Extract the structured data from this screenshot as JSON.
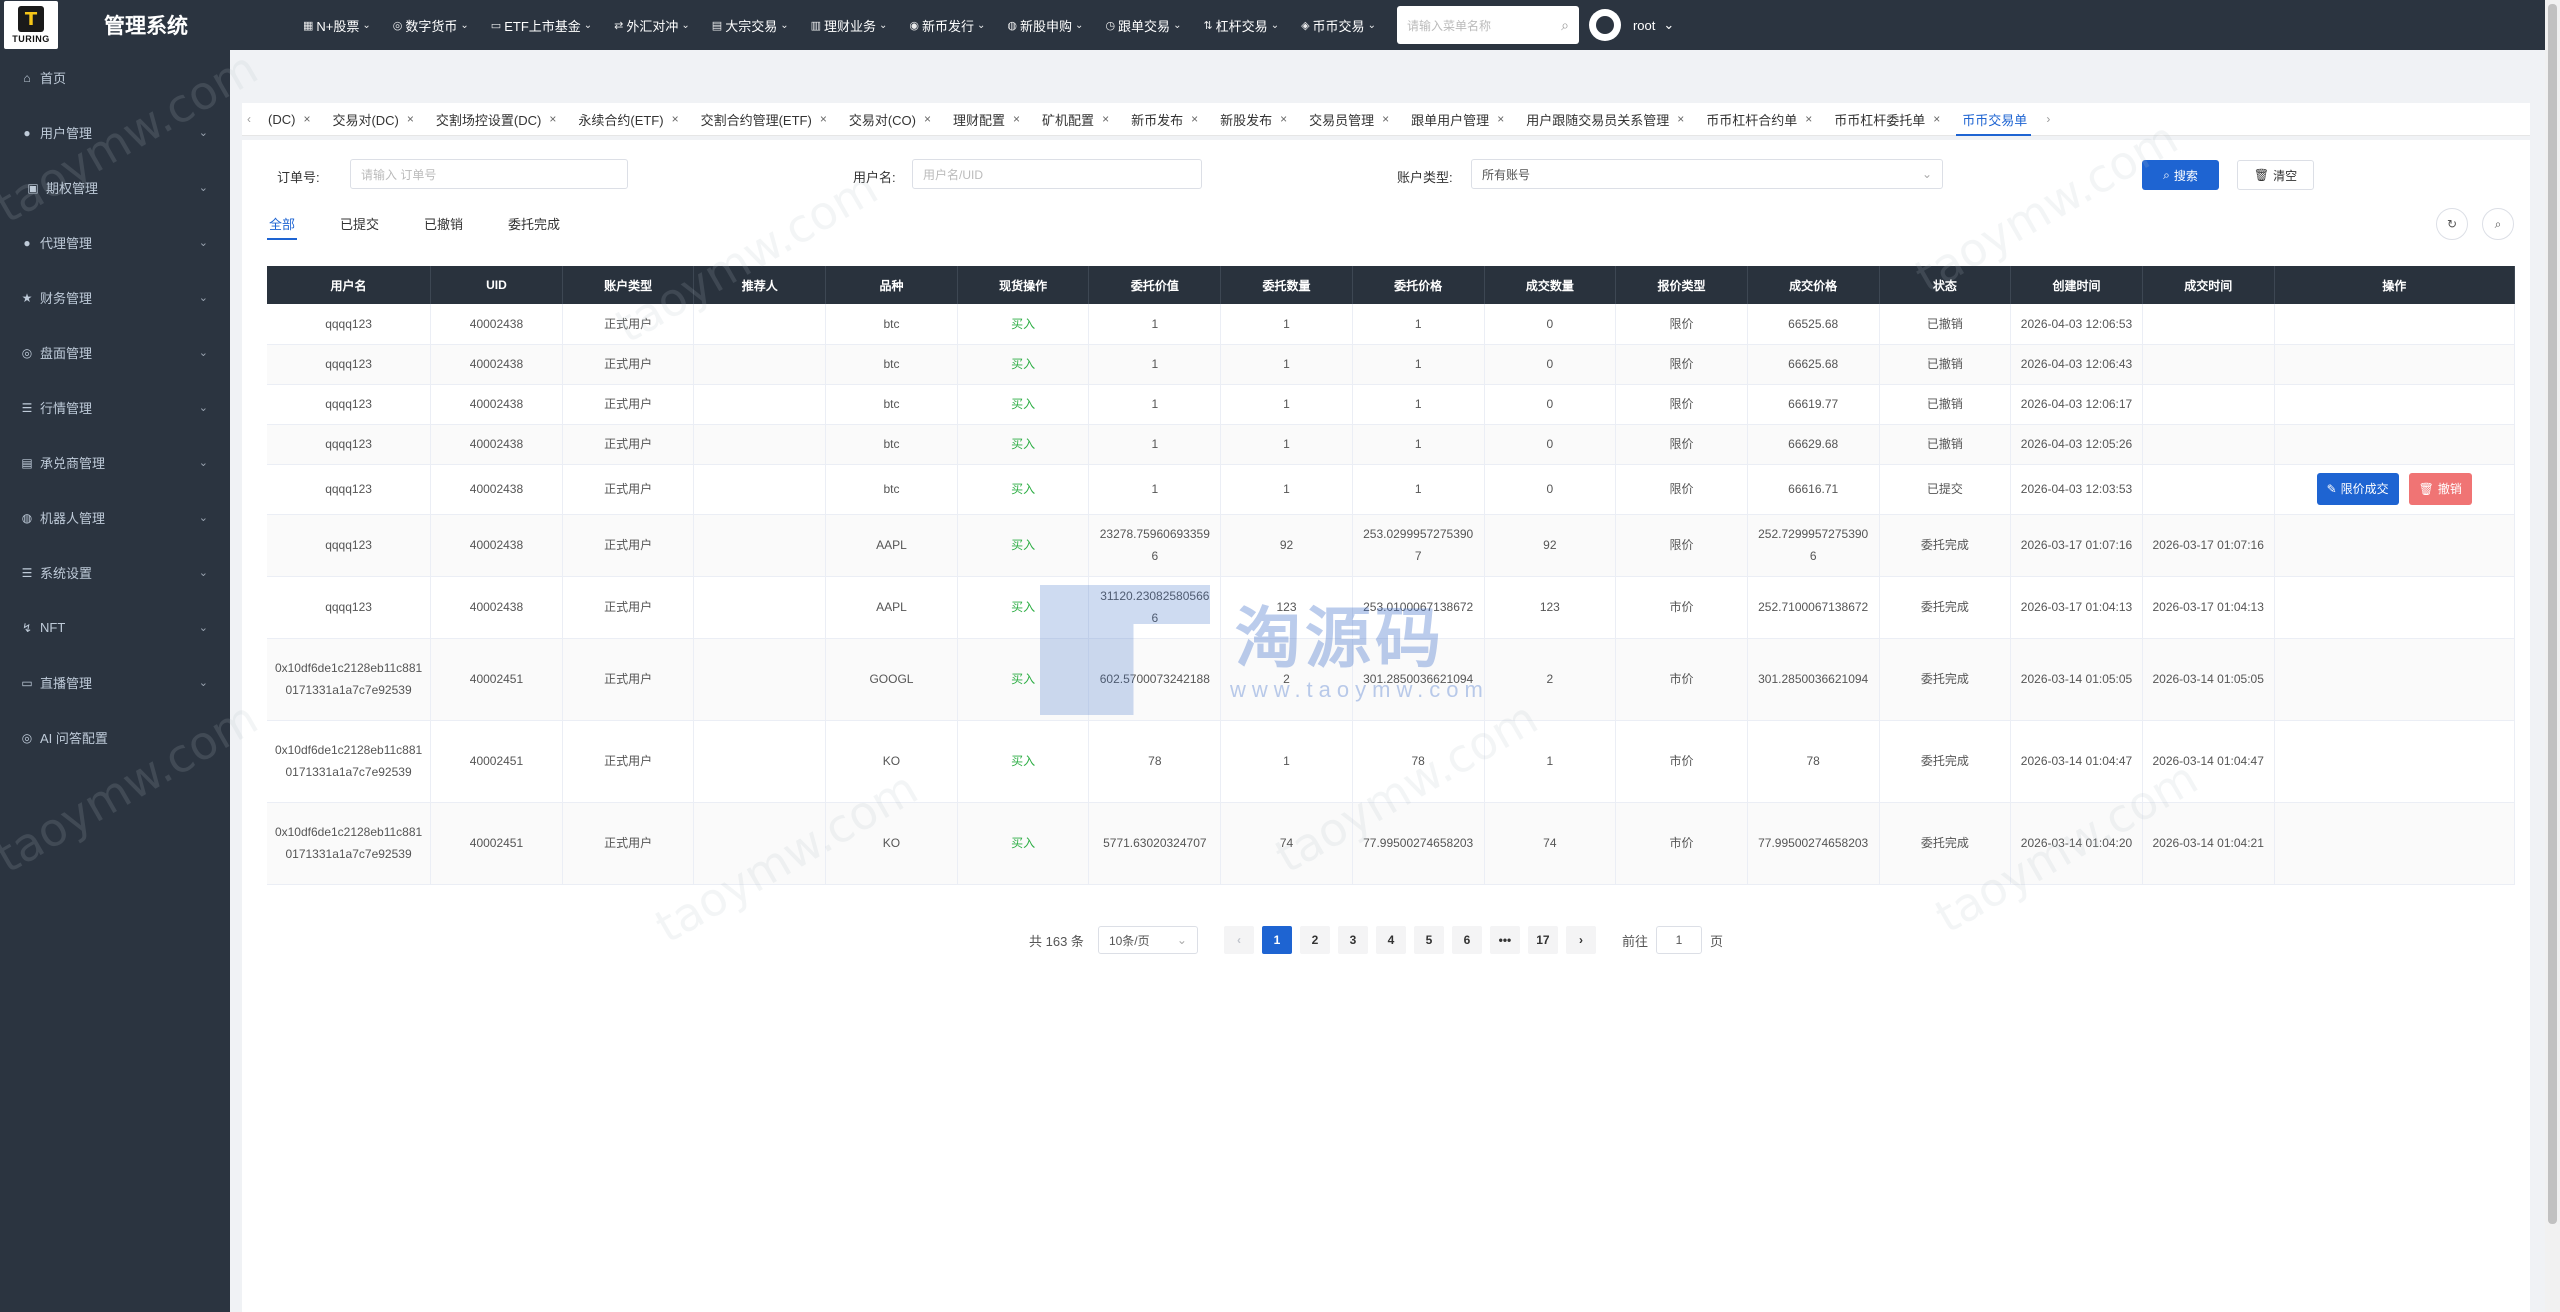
{
  "app": {
    "logo_mark": "T",
    "logo_text": "TURING",
    "title": "管理系统"
  },
  "topnav": [
    {
      "label": "N+股票",
      "icon": "stock-icon"
    },
    {
      "label": "数字货币",
      "icon": "coin-icon"
    },
    {
      "label": "ETF上市基金",
      "icon": "fund-icon"
    },
    {
      "label": "外汇对冲",
      "icon": "forex-icon"
    },
    {
      "label": "大宗交易",
      "icon": "bulk-icon"
    },
    {
      "label": "理财业务",
      "icon": "finance-icon"
    },
    {
      "label": "新币发行",
      "icon": "newcoin-icon"
    },
    {
      "label": "新股申购",
      "icon": "ipo-icon"
    },
    {
      "label": "跟单交易",
      "icon": "copy-trade-icon"
    },
    {
      "label": "杠杆交易",
      "icon": "leverage-icon"
    },
    {
      "label": "币币交易",
      "icon": "spot-icon"
    }
  ],
  "search": {
    "placeholder": "请输入菜单名称"
  },
  "user": {
    "name": "root"
  },
  "sidebar": [
    {
      "label": "首页",
      "icon": "home-icon",
      "expandable": false
    },
    {
      "label": "用户管理",
      "icon": "user-icon",
      "expandable": true
    },
    {
      "label": "期权管理",
      "icon": "option-icon",
      "expandable": true
    },
    {
      "label": "代理管理",
      "icon": "agent-icon",
      "expandable": true
    },
    {
      "label": "财务管理",
      "icon": "star-icon",
      "expandable": true
    },
    {
      "label": "盘面管理",
      "icon": "market-board-icon",
      "expandable": true
    },
    {
      "label": "行情管理",
      "icon": "list-icon",
      "expandable": true
    },
    {
      "label": "承兑商管理",
      "icon": "merchant-icon",
      "expandable": true
    },
    {
      "label": "机器人管理",
      "icon": "robot-icon",
      "expandable": true
    },
    {
      "label": "系统设置",
      "icon": "settings-icon",
      "expandable": true
    },
    {
      "label": "NFT",
      "icon": "nft-icon",
      "expandable": true
    },
    {
      "label": "直播管理",
      "icon": "live-icon",
      "expandable": true
    },
    {
      "label": "AI 问答配置",
      "icon": "ai-icon",
      "expandable": false
    }
  ],
  "tabs": [
    {
      "label": "(DC)",
      "active": false
    },
    {
      "label": "交易对(DC)",
      "active": false
    },
    {
      "label": "交割场控设置(DC)",
      "active": false
    },
    {
      "label": "永续合约(ETF)",
      "active": false
    },
    {
      "label": "交割合约管理(ETF)",
      "active": false
    },
    {
      "label": "交易对(CO)",
      "active": false
    },
    {
      "label": "理财配置",
      "active": false
    },
    {
      "label": "矿机配置",
      "active": false
    },
    {
      "label": "新币发布",
      "active": false
    },
    {
      "label": "新股发布",
      "active": false
    },
    {
      "label": "交易员管理",
      "active": false
    },
    {
      "label": "跟单用户管理",
      "active": false
    },
    {
      "label": "用户跟随交易员关系管理",
      "active": false
    },
    {
      "label": "币币杠杆合约单",
      "active": false
    },
    {
      "label": "币币杠杆委托单",
      "active": false
    },
    {
      "label": "币币交易单",
      "active": true
    }
  ],
  "filters": {
    "order_label": "订单号:",
    "order_placeholder": "请输入 订单号",
    "user_label": "用户名:",
    "user_placeholder": "用户名/UID",
    "account_label": "账户类型:",
    "account_value": "所有账号",
    "search_btn": "搜索",
    "reset_btn": "清空"
  },
  "subtabs": [
    {
      "label": "全部",
      "active": true
    },
    {
      "label": "已提交",
      "active": false
    },
    {
      "label": "已撤销",
      "active": false
    },
    {
      "label": "委托完成",
      "active": false
    }
  ],
  "table": {
    "columns": [
      "用户名",
      "UID",
      "账户类型",
      "推荐人",
      "品种",
      "现货操作",
      "委托价值",
      "委托数量",
      "委托价格",
      "成交数量",
      "报价类型",
      "成交价格",
      "状态",
      "创建时间",
      "成交时间",
      "操作"
    ],
    "rows": [
      [
        "qqqq123",
        "40002438",
        "正式用户",
        "",
        "btc",
        "买入",
        "1",
        "1",
        "1",
        "0",
        "限价",
        "66525.68",
        "已撤销",
        "2026-04-03 12:06:53",
        "",
        ""
      ],
      [
        "qqqq123",
        "40002438",
        "正式用户",
        "",
        "btc",
        "买入",
        "1",
        "1",
        "1",
        "0",
        "限价",
        "66625.68",
        "已撤销",
        "2026-04-03 12:06:43",
        "",
        ""
      ],
      [
        "qqqq123",
        "40002438",
        "正式用户",
        "",
        "btc",
        "买入",
        "1",
        "1",
        "1",
        "0",
        "限价",
        "66619.77",
        "已撤销",
        "2026-04-03 12:06:17",
        "",
        ""
      ],
      [
        "qqqq123",
        "40002438",
        "正式用户",
        "",
        "btc",
        "买入",
        "1",
        "1",
        "1",
        "0",
        "限价",
        "66629.68",
        "已撤销",
        "2026-04-03 12:05:26",
        "",
        ""
      ],
      [
        "qqqq123",
        "40002438",
        "正式用户",
        "",
        "btc",
        "买入",
        "1",
        "1",
        "1",
        "0",
        "限价",
        "66616.71",
        "已提交",
        "2026-04-03 12:03:53",
        "",
        "actions"
      ],
      [
        "qqqq123",
        "40002438",
        "正式用户",
        "",
        "AAPL",
        "买入",
        "23278.75960693359 6",
        "92",
        "253.0299957275390 7",
        "92",
        "限价",
        "252.7299957275390 6",
        "委托完成",
        "2026-03-17 01:07:16",
        "2026-03-17 01:07:16",
        ""
      ],
      [
        "qqqq123",
        "40002438",
        "正式用户",
        "",
        "AAPL",
        "买入",
        "31120.23082580566 6",
        "123",
        "253.0100067138672",
        "123",
        "市价",
        "252.7100067138672",
        "委托完成",
        "2026-03-17 01:04:13",
        "2026-03-17 01:04:13",
        ""
      ],
      [
        "0x10df6de1c2128eb11c8810171331a1a7c7e92539",
        "40002451",
        "正式用户",
        "",
        "GOOGL",
        "买入",
        "602.5700073242188",
        "2",
        "301.2850036621094",
        "2",
        "市价",
        "301.2850036621094",
        "委托完成",
        "2026-03-14 01:05:05",
        "2026-03-14 01:05:05",
        ""
      ],
      [
        "0x10df6de1c2128eb11c8810171331a1a7c7e92539",
        "40002451",
        "正式用户",
        "",
        "KO",
        "买入",
        "78",
        "1",
        "78",
        "1",
        "市价",
        "78",
        "委托完成",
        "2026-03-14 01:04:47",
        "2026-03-14 01:04:47",
        ""
      ],
      [
        "0x10df6de1c2128eb11c8810171331a1a7c7e92539",
        "40002451",
        "正式用户",
        "",
        "KO",
        "买入",
        "5771.63020324707",
        "74",
        "77.99500274658203",
        "74",
        "市价",
        "77.99500274658203",
        "委托完成",
        "2026-03-14 01:04:20",
        "2026-03-14 01:04:21",
        ""
      ]
    ],
    "action_limit": "限价成交",
    "action_cancel": "撤销"
  },
  "pagination": {
    "total": "共 163 条",
    "page_size": "10条/页",
    "pages": [
      "1",
      "2",
      "3",
      "4",
      "5",
      "6",
      "•••",
      "17"
    ],
    "current": "1",
    "goto_label": "前往",
    "goto_value": "1",
    "goto_suffix": "页"
  },
  "watermark": {
    "text": "taoymw.com",
    "center_cn": "淘源码",
    "center_en": "www.taoymw.com"
  },
  "colors": {
    "topbar": "#2b3440",
    "accent": "#1e64d2",
    "buy": "#2eae45",
    "cancel_btn": "#f07474"
  }
}
